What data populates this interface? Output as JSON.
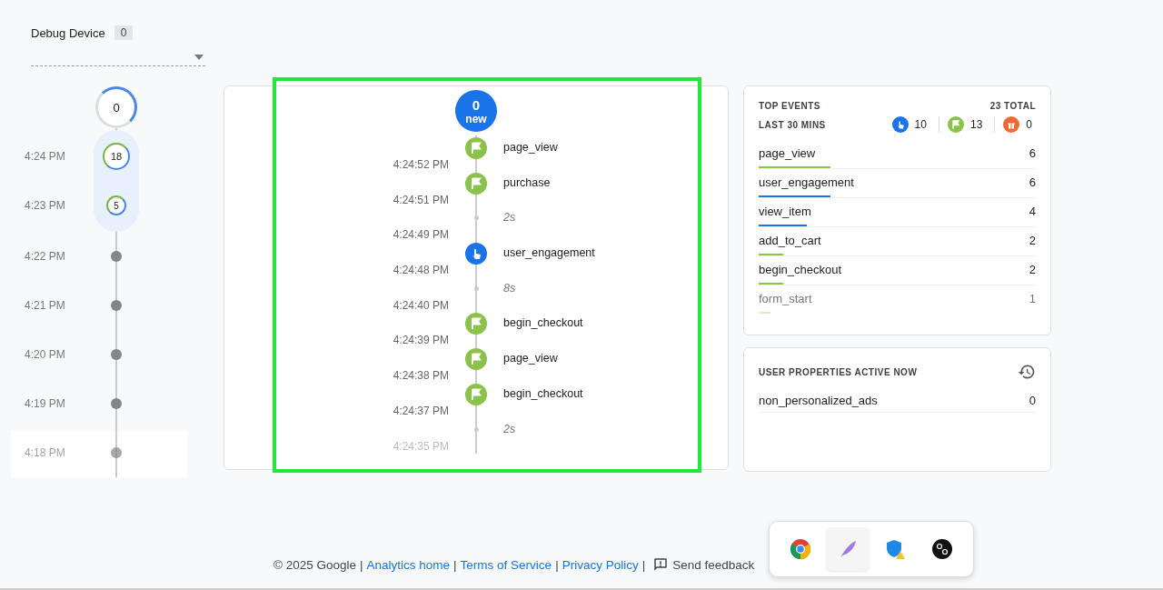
{
  "debug_device": {
    "label": "Debug Device",
    "count": "0"
  },
  "minutes": {
    "current": "0",
    "items": [
      {
        "time": "4:24 PM",
        "count": "18",
        "kind": "ring",
        "selected": true
      },
      {
        "time": "4:23 PM",
        "count": "5",
        "kind": "ring",
        "selected": true
      },
      {
        "time": "4:22 PM",
        "kind": "dot",
        "selected": false
      },
      {
        "time": "4:21 PM",
        "kind": "dot",
        "selected": false
      },
      {
        "time": "4:20 PM",
        "kind": "dot",
        "selected": false
      },
      {
        "time": "4:19 PM",
        "kind": "dot",
        "selected": false
      },
      {
        "time": "4:18 PM",
        "kind": "dot",
        "selected": false
      }
    ]
  },
  "stream": {
    "new_count": "0",
    "new_label": "new",
    "items": [
      {
        "kind": "conversion",
        "label": "page_view",
        "time": "4:24:52 PM"
      },
      {
        "kind": "conversion",
        "label": "purchase",
        "time": "4:24:51 PM"
      },
      {
        "kind": "gap",
        "label": "2s",
        "time": "4:24:49 PM"
      },
      {
        "kind": "engagement",
        "label": "user_engagement",
        "time": "4:24:48 PM"
      },
      {
        "kind": "gap",
        "label": "8s",
        "time": "4:24:40 PM"
      },
      {
        "kind": "conversion",
        "label": "begin_checkout",
        "time": "4:24:39 PM"
      },
      {
        "kind": "conversion",
        "label": "page_view",
        "time": "4:24:38 PM"
      },
      {
        "kind": "conversion",
        "label": "begin_checkout",
        "time": "4:24:37 PM"
      },
      {
        "kind": "gap",
        "label": "2s",
        "time": "4:24:35 PM"
      }
    ]
  },
  "top_events": {
    "title": "TOP EVENTS",
    "total": "23 TOTAL",
    "period": "LAST 30 MINS",
    "counts": [
      {
        "kind": "engagement",
        "value": "10"
      },
      {
        "kind": "conversion",
        "value": "13"
      },
      {
        "kind": "error",
        "value": "0"
      }
    ],
    "rows": [
      {
        "name": "page_view",
        "count": "6",
        "level": 0.26,
        "color": "#8bc34a"
      },
      {
        "name": "user_engagement",
        "count": "6",
        "level": 0.26,
        "color": "#1a73e8"
      },
      {
        "name": "view_item",
        "count": "4",
        "level": 0.175,
        "color": "#1a73e8"
      },
      {
        "name": "add_to_cart",
        "count": "2",
        "level": 0.087,
        "color": "#8bc34a"
      },
      {
        "name": "begin_checkout",
        "count": "2",
        "level": 0.087,
        "color": "#8bc34a"
      },
      {
        "name": "form_start",
        "count": "1",
        "level": 0.044,
        "color": "#dcedc8"
      }
    ]
  },
  "user_properties": {
    "title": "USER PROPERTIES ACTIVE NOW",
    "rows": [
      {
        "name": "non_personalized_ads",
        "value": "0"
      }
    ]
  },
  "footer": {
    "copyright": "© 2025 Google",
    "separators": [
      "|",
      "|",
      "|",
      "|"
    ],
    "links": [
      "Analytics home",
      "Terms of Service",
      "Privacy Policy"
    ],
    "feedback": "Send feedback"
  },
  "dock": [
    {
      "kind": "browser",
      "selected": false
    },
    {
      "kind": "feather",
      "selected": true
    },
    {
      "kind": "shield",
      "selected": false
    },
    {
      "kind": "logo",
      "selected": false
    }
  ]
}
